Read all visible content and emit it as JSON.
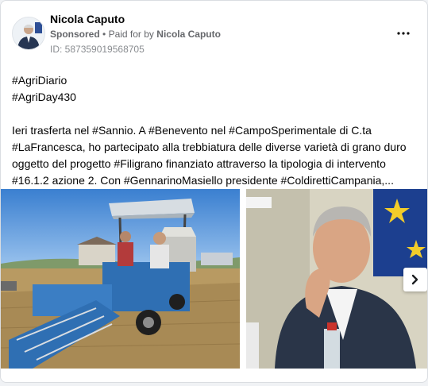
{
  "post": {
    "author": "Nicola Caputo",
    "sponsored": "Sponsored",
    "paid_prefix": "Paid for by",
    "paid_by": "Nicola Caputo",
    "ad_id": "ID: 587359019568705",
    "lines": {
      "l1": "#AgriDiario",
      "l2": "#AgriDay430",
      "l3": "Ieri trasferta nel #Sannio. A #Benevento nel #CampoSperimentale di C.ta",
      "l4": "#LaFrancesca, ho partecipato alla trebbiatura delle diverse varietà di grano duro",
      "l5": "oggetto del progetto #Filigrano finanziato attraverso la tipologia di intervento",
      "l6": "#16.1.2 azione 2. Con #GennarinoMasiello presidente #ColdirettiCampania,..."
    },
    "icons": {
      "more": "more-options-icon",
      "next": "chevron-right-icon"
    }
  }
}
